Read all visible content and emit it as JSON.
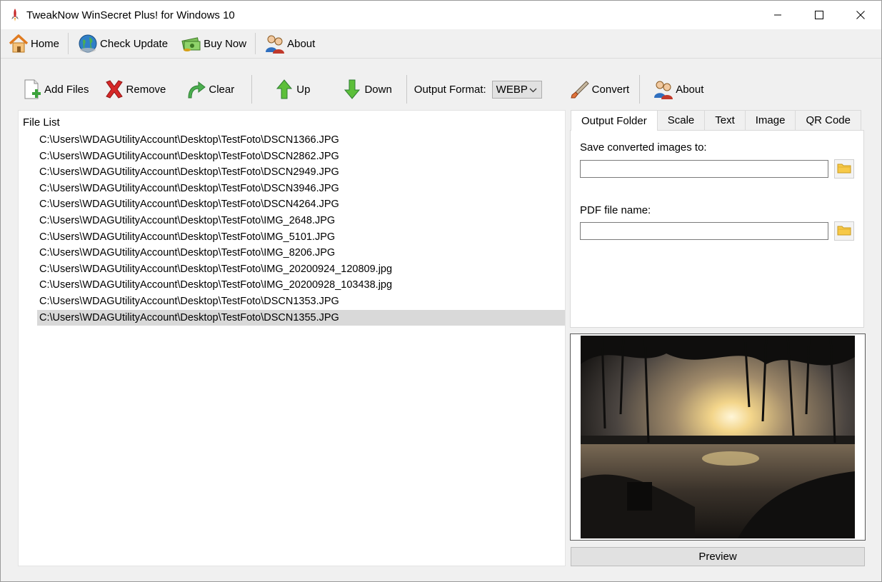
{
  "window": {
    "title": "TweakNow WinSecret Plus! for Windows 10"
  },
  "menubar": {
    "items": [
      {
        "label": "Home",
        "icon": "home-icon"
      },
      {
        "label": "Check Update",
        "icon": "globe-icon"
      },
      {
        "label": "Buy Now",
        "icon": "money-icon"
      },
      {
        "label": "About",
        "icon": "users-icon"
      }
    ]
  },
  "toolbar": {
    "add_files": "Add Files",
    "remove": "Remove",
    "clear": "Clear",
    "up": "Up",
    "down": "Down",
    "output_format_label": "Output Format:",
    "output_format_value": "WEBP",
    "convert": "Convert",
    "about": "About"
  },
  "filelist": {
    "header": "File List",
    "files": [
      "C:\\Users\\WDAGUtilityAccount\\Desktop\\TestFoto\\DSCN1366.JPG",
      "C:\\Users\\WDAGUtilityAccount\\Desktop\\TestFoto\\DSCN2862.JPG",
      "C:\\Users\\WDAGUtilityAccount\\Desktop\\TestFoto\\DSCN2949.JPG",
      "C:\\Users\\WDAGUtilityAccount\\Desktop\\TestFoto\\DSCN3946.JPG",
      "C:\\Users\\WDAGUtilityAccount\\Desktop\\TestFoto\\DSCN4264.JPG",
      "C:\\Users\\WDAGUtilityAccount\\Desktop\\TestFoto\\IMG_2648.JPG",
      "C:\\Users\\WDAGUtilityAccount\\Desktop\\TestFoto\\IMG_5101.JPG",
      "C:\\Users\\WDAGUtilityAccount\\Desktop\\TestFoto\\IMG_8206.JPG",
      "C:\\Users\\WDAGUtilityAccount\\Desktop\\TestFoto\\IMG_20200924_120809.jpg",
      "C:\\Users\\WDAGUtilityAccount\\Desktop\\TestFoto\\IMG_20200928_103438.jpg",
      "C:\\Users\\WDAGUtilityAccount\\Desktop\\TestFoto\\DSCN1353.JPG",
      "C:\\Users\\WDAGUtilityAccount\\Desktop\\TestFoto\\DSCN1355.JPG"
    ],
    "selected_index": 11
  },
  "tabs": {
    "items": [
      "Output Folder",
      "Scale",
      "Text",
      "Image",
      "QR Code"
    ],
    "active": "Output Folder"
  },
  "output_folder": {
    "save_label": "Save converted images to:",
    "save_value": "",
    "pdf_label": "PDF file name:",
    "pdf_value": ""
  },
  "preview": {
    "button_label": "Preview"
  },
  "colors": {
    "selected_row": "#d9d9d9",
    "window_bg": "#f0f0f0"
  }
}
